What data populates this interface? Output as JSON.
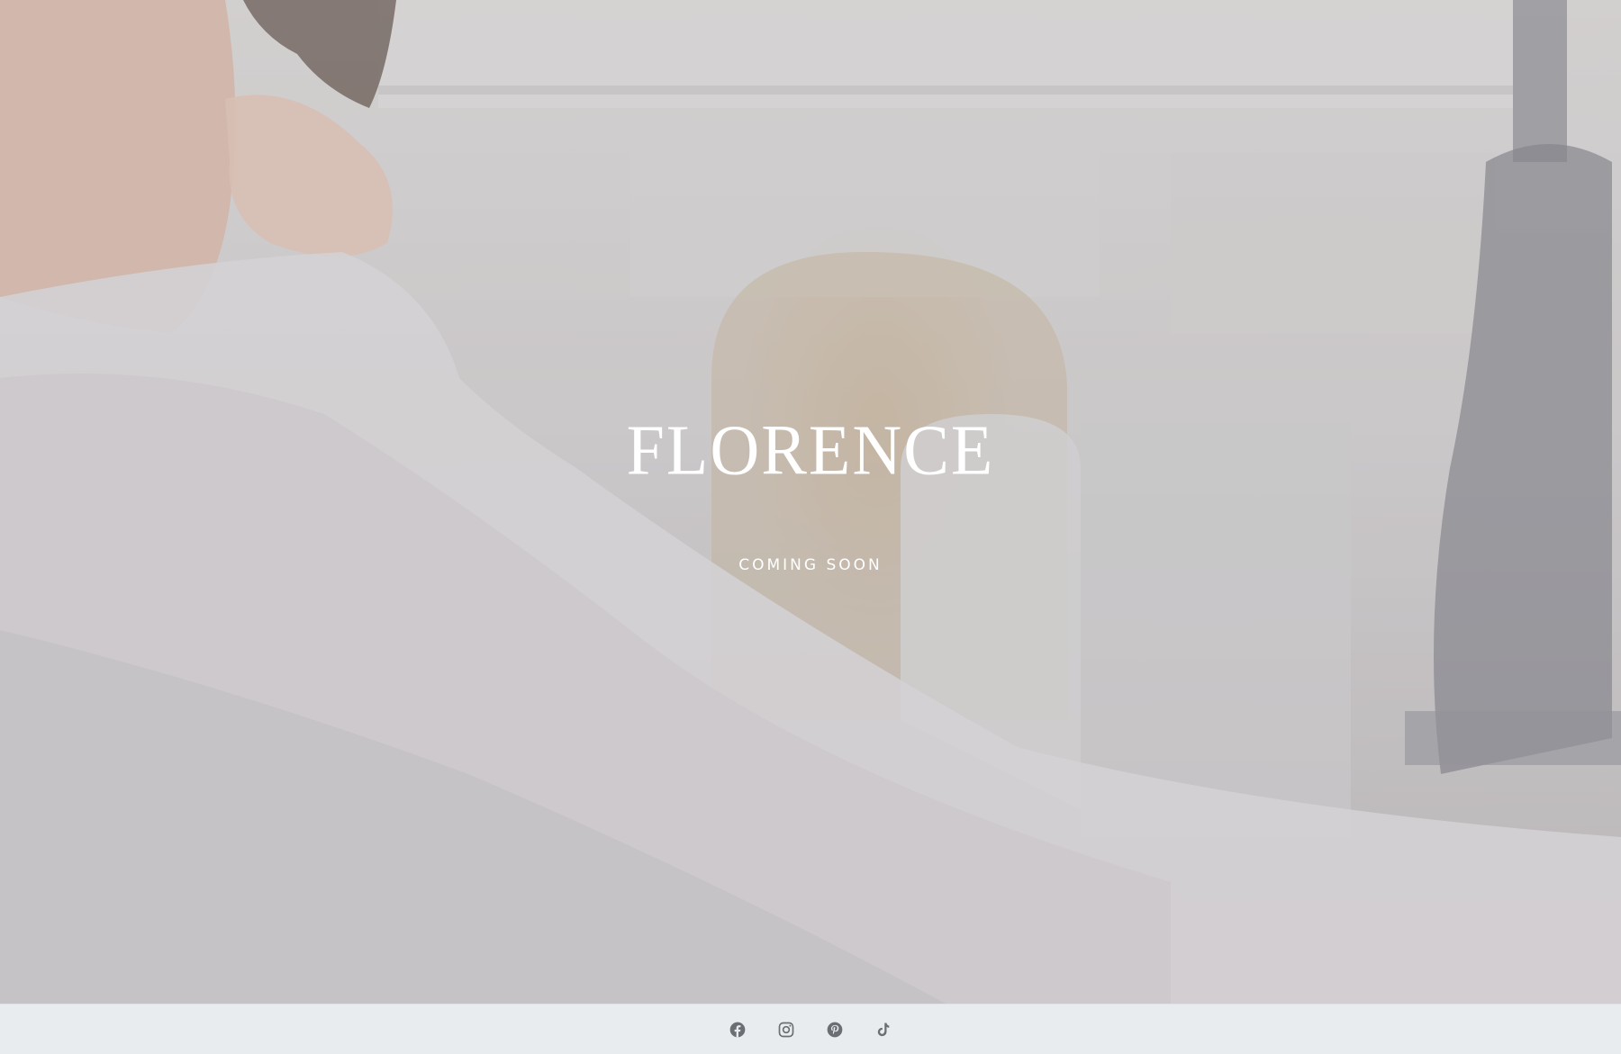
{
  "hero": {
    "title": "FLORENCE",
    "tagline": "COMING SOON"
  },
  "footer": {
    "social": [
      {
        "name": "Facebook",
        "icon": "facebook-icon"
      },
      {
        "name": "Instagram",
        "icon": "instagram-icon"
      },
      {
        "name": "Pinterest",
        "icon": "pinterest-icon"
      },
      {
        "name": "TikTok",
        "icon": "tiktok-icon"
      }
    ]
  },
  "colors": {
    "title_text": "#ffffff",
    "footer_background": "#e9ecee",
    "icon": "#6b6e72"
  }
}
